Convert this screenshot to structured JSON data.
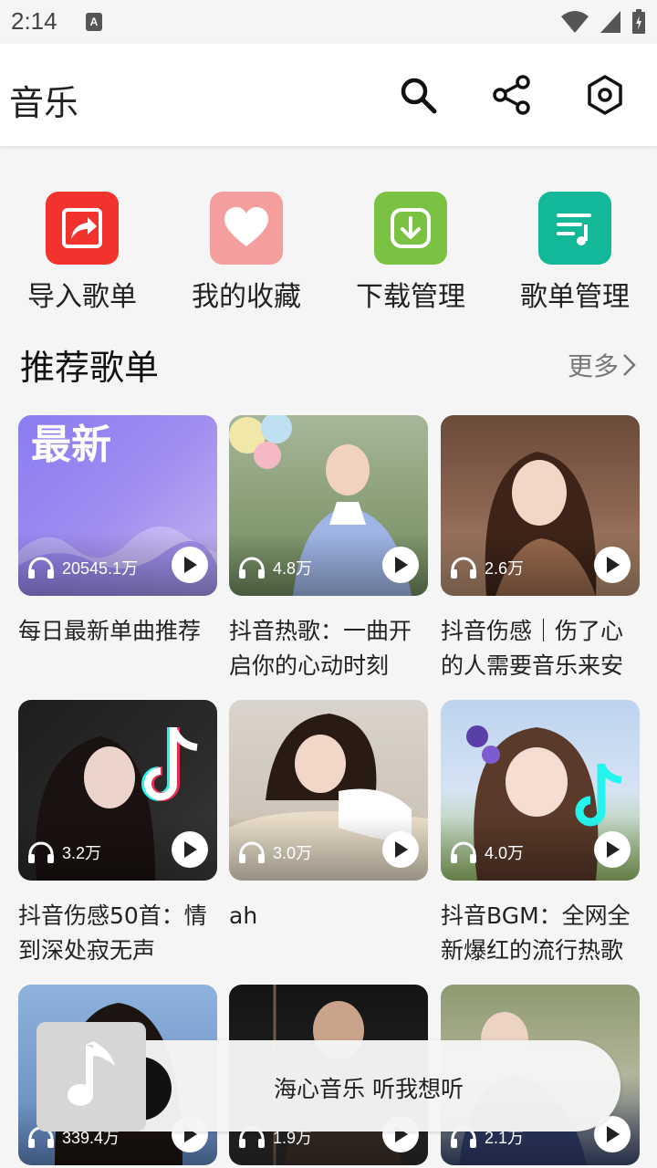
{
  "status_bar": {
    "time": "2:14",
    "notif_icon": "A"
  },
  "app_bar": {
    "title": "音乐"
  },
  "quick_actions": [
    {
      "label": "导入歌单",
      "icon": "import-icon",
      "color": "#f2322d"
    },
    {
      "label": "我的收藏",
      "icon": "heart-icon",
      "color": "#f59e9e"
    },
    {
      "label": "下载管理",
      "icon": "download-icon",
      "color": "#7cc242"
    },
    {
      "label": "歌单管理",
      "icon": "playlist-icon",
      "color": "#13b898"
    }
  ],
  "section": {
    "title": "推荐歌单",
    "more": "更多"
  },
  "playlists": [
    {
      "name": "每日最新单曲推荐",
      "plays": "20545.1万",
      "cover_text": "最新"
    },
    {
      "name": "抖音热歌：一曲开启你的心动时刻",
      "plays": "4.8万"
    },
    {
      "name": "抖音伤感｜伤了心的人需要音乐来安",
      "plays": "2.6万"
    },
    {
      "name": "抖音伤感50首：情到深处寂无声",
      "plays": "3.2万"
    },
    {
      "name": "ah",
      "plays": "3.0万"
    },
    {
      "name": "抖音BGM：全网全新爆红的流行热歌",
      "plays": "4.0万"
    },
    {
      "name": "",
      "plays": "339.4万"
    },
    {
      "name": "",
      "plays": "1.9万"
    },
    {
      "name": "",
      "plays": "2.1万"
    }
  ],
  "mini_player": {
    "text": "海心音乐 听我想听"
  }
}
